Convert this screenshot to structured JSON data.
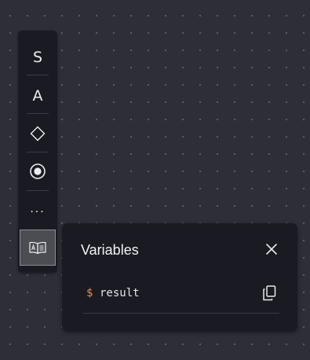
{
  "toolbar": {
    "tools": [
      {
        "id": "string-tool",
        "label": "S"
      },
      {
        "id": "array-tool",
        "label": "A"
      },
      {
        "id": "shape-tool",
        "icon": "diamond-icon"
      },
      {
        "id": "radio-tool",
        "icon": "radio-target-icon"
      },
      {
        "id": "more-tool",
        "label": "..."
      },
      {
        "id": "variables-tool",
        "icon": "book-icon",
        "active": true
      }
    ]
  },
  "variables_panel": {
    "title": "Variables",
    "close_icon": "close-icon",
    "variables": [
      {
        "prefix": "$",
        "name": "result",
        "action_icon": "copy-icon"
      }
    ]
  },
  "colors": {
    "canvas": "#2e2e38",
    "panel": "#1a1b22",
    "accent_dollar": "#ee8a45",
    "active_tool": "#4c4c53"
  }
}
